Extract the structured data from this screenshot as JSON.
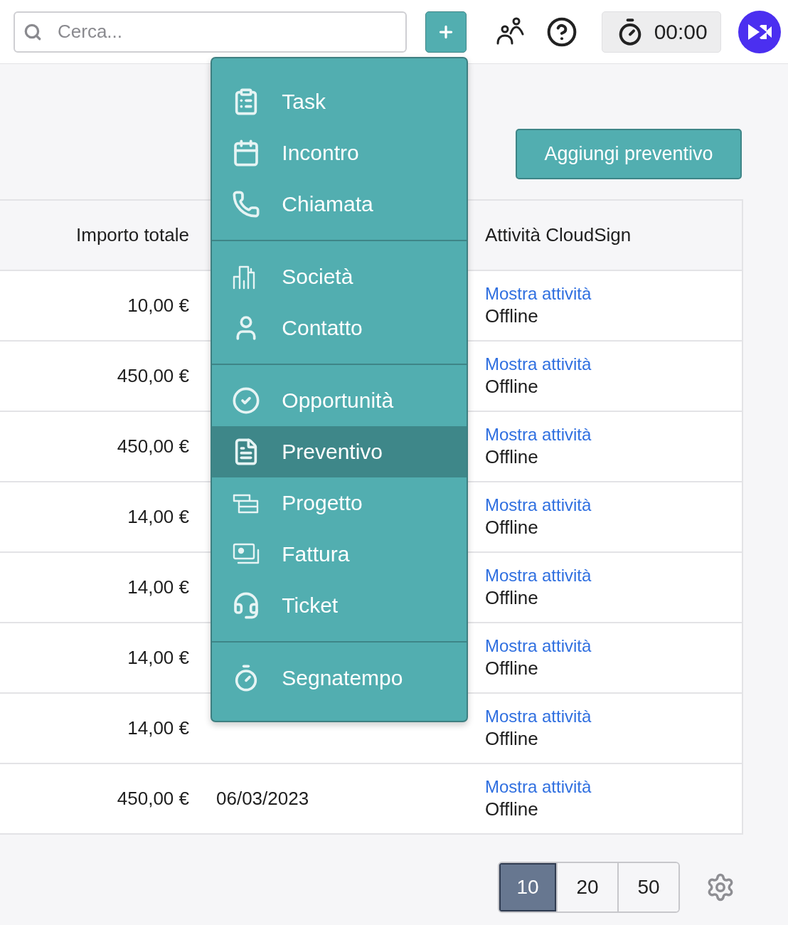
{
  "search": {
    "placeholder": "Cerca..."
  },
  "timer": {
    "time": "00:00"
  },
  "menu": {
    "sections": [
      {
        "items": [
          {
            "label": "Task",
            "selected": false
          },
          {
            "label": "Incontro",
            "selected": false
          },
          {
            "label": "Chiamata",
            "selected": false
          }
        ]
      },
      {
        "items": [
          {
            "label": "Società",
            "selected": false
          },
          {
            "label": "Contatto",
            "selected": false
          }
        ]
      },
      {
        "items": [
          {
            "label": "Opportunità",
            "selected": false
          },
          {
            "label": "Preventivo",
            "selected": true
          },
          {
            "label": "Progetto",
            "selected": false
          },
          {
            "label": "Fattura",
            "selected": false
          },
          {
            "label": "Ticket",
            "selected": false
          }
        ]
      },
      {
        "items": [
          {
            "label": "Segnatempo",
            "selected": false
          }
        ]
      }
    ]
  },
  "add_quote_button": "Aggiungi preventivo",
  "table": {
    "header": {
      "amount": "Importo totale",
      "cloudsign": "Attività CloudSign"
    },
    "rows": [
      {
        "amount": "10,00 €",
        "link": "Mostra attività",
        "status": "Offline"
      },
      {
        "amount": "450,00 €",
        "link": "Mostra attività",
        "status": "Offline"
      },
      {
        "amount": "450,00 €",
        "link": "Mostra attività",
        "status": "Offline"
      },
      {
        "amount": "14,00 €",
        "link": "Mostra attività",
        "status": "Offline"
      },
      {
        "amount": "14,00 €",
        "link": "Mostra attività",
        "status": "Offline"
      },
      {
        "amount": "14,00 €",
        "link": "Mostra attività",
        "status": "Offline"
      },
      {
        "amount": "14,00 €",
        "link": "Mostra attività",
        "status": "Offline"
      },
      {
        "amount": "450,00 €",
        "date": "06/03/2023",
        "link": "Mostra attività",
        "status": "Offline"
      }
    ]
  },
  "page_sizes": [
    {
      "label": "10",
      "selected": true
    },
    {
      "label": "20",
      "selected": false
    },
    {
      "label": "50",
      "selected": false
    }
  ]
}
